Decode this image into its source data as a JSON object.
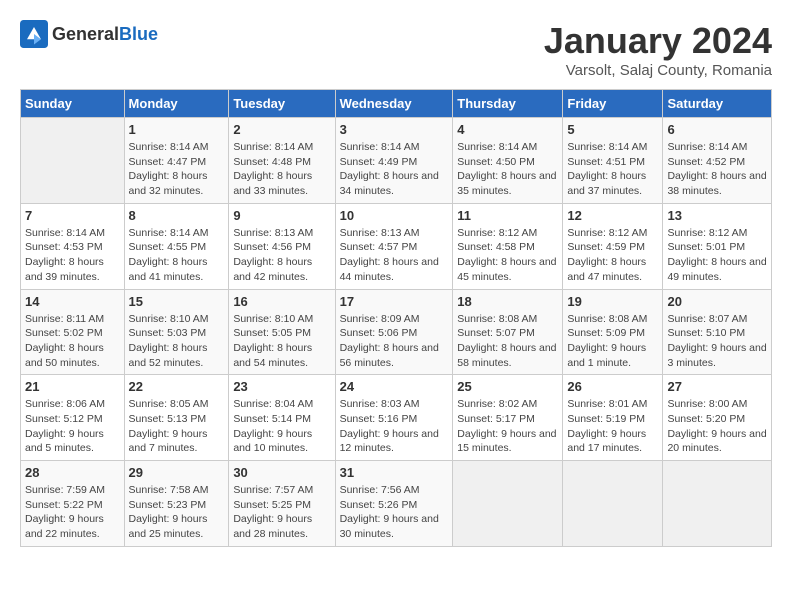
{
  "header": {
    "logo_general": "General",
    "logo_blue": "Blue",
    "month_title": "January 2024",
    "subtitle": "Varsolt, Salaj County, Romania"
  },
  "calendar": {
    "days_of_week": [
      "Sunday",
      "Monday",
      "Tuesday",
      "Wednesday",
      "Thursday",
      "Friday",
      "Saturday"
    ],
    "weeks": [
      [
        {
          "day": "",
          "sunrise": "",
          "sunset": "",
          "daylight": ""
        },
        {
          "day": "1",
          "sunrise": "Sunrise: 8:14 AM",
          "sunset": "Sunset: 4:47 PM",
          "daylight": "Daylight: 8 hours and 32 minutes."
        },
        {
          "day": "2",
          "sunrise": "Sunrise: 8:14 AM",
          "sunset": "Sunset: 4:48 PM",
          "daylight": "Daylight: 8 hours and 33 minutes."
        },
        {
          "day": "3",
          "sunrise": "Sunrise: 8:14 AM",
          "sunset": "Sunset: 4:49 PM",
          "daylight": "Daylight: 8 hours and 34 minutes."
        },
        {
          "day": "4",
          "sunrise": "Sunrise: 8:14 AM",
          "sunset": "Sunset: 4:50 PM",
          "daylight": "Daylight: 8 hours and 35 minutes."
        },
        {
          "day": "5",
          "sunrise": "Sunrise: 8:14 AM",
          "sunset": "Sunset: 4:51 PM",
          "daylight": "Daylight: 8 hours and 37 minutes."
        },
        {
          "day": "6",
          "sunrise": "Sunrise: 8:14 AM",
          "sunset": "Sunset: 4:52 PM",
          "daylight": "Daylight: 8 hours and 38 minutes."
        }
      ],
      [
        {
          "day": "7",
          "sunrise": "Sunrise: 8:14 AM",
          "sunset": "Sunset: 4:53 PM",
          "daylight": "Daylight: 8 hours and 39 minutes."
        },
        {
          "day": "8",
          "sunrise": "Sunrise: 8:14 AM",
          "sunset": "Sunset: 4:55 PM",
          "daylight": "Daylight: 8 hours and 41 minutes."
        },
        {
          "day": "9",
          "sunrise": "Sunrise: 8:13 AM",
          "sunset": "Sunset: 4:56 PM",
          "daylight": "Daylight: 8 hours and 42 minutes."
        },
        {
          "day": "10",
          "sunrise": "Sunrise: 8:13 AM",
          "sunset": "Sunset: 4:57 PM",
          "daylight": "Daylight: 8 hours and 44 minutes."
        },
        {
          "day": "11",
          "sunrise": "Sunrise: 8:12 AM",
          "sunset": "Sunset: 4:58 PM",
          "daylight": "Daylight: 8 hours and 45 minutes."
        },
        {
          "day": "12",
          "sunrise": "Sunrise: 8:12 AM",
          "sunset": "Sunset: 4:59 PM",
          "daylight": "Daylight: 8 hours and 47 minutes."
        },
        {
          "day": "13",
          "sunrise": "Sunrise: 8:12 AM",
          "sunset": "Sunset: 5:01 PM",
          "daylight": "Daylight: 8 hours and 49 minutes."
        }
      ],
      [
        {
          "day": "14",
          "sunrise": "Sunrise: 8:11 AM",
          "sunset": "Sunset: 5:02 PM",
          "daylight": "Daylight: 8 hours and 50 minutes."
        },
        {
          "day": "15",
          "sunrise": "Sunrise: 8:10 AM",
          "sunset": "Sunset: 5:03 PM",
          "daylight": "Daylight: 8 hours and 52 minutes."
        },
        {
          "day": "16",
          "sunrise": "Sunrise: 8:10 AM",
          "sunset": "Sunset: 5:05 PM",
          "daylight": "Daylight: 8 hours and 54 minutes."
        },
        {
          "day": "17",
          "sunrise": "Sunrise: 8:09 AM",
          "sunset": "Sunset: 5:06 PM",
          "daylight": "Daylight: 8 hours and 56 minutes."
        },
        {
          "day": "18",
          "sunrise": "Sunrise: 8:08 AM",
          "sunset": "Sunset: 5:07 PM",
          "daylight": "Daylight: 8 hours and 58 minutes."
        },
        {
          "day": "19",
          "sunrise": "Sunrise: 8:08 AM",
          "sunset": "Sunset: 5:09 PM",
          "daylight": "Daylight: 9 hours and 1 minute."
        },
        {
          "day": "20",
          "sunrise": "Sunrise: 8:07 AM",
          "sunset": "Sunset: 5:10 PM",
          "daylight": "Daylight: 9 hours and 3 minutes."
        }
      ],
      [
        {
          "day": "21",
          "sunrise": "Sunrise: 8:06 AM",
          "sunset": "Sunset: 5:12 PM",
          "daylight": "Daylight: 9 hours and 5 minutes."
        },
        {
          "day": "22",
          "sunrise": "Sunrise: 8:05 AM",
          "sunset": "Sunset: 5:13 PM",
          "daylight": "Daylight: 9 hours and 7 minutes."
        },
        {
          "day": "23",
          "sunrise": "Sunrise: 8:04 AM",
          "sunset": "Sunset: 5:14 PM",
          "daylight": "Daylight: 9 hours and 10 minutes."
        },
        {
          "day": "24",
          "sunrise": "Sunrise: 8:03 AM",
          "sunset": "Sunset: 5:16 PM",
          "daylight": "Daylight: 9 hours and 12 minutes."
        },
        {
          "day": "25",
          "sunrise": "Sunrise: 8:02 AM",
          "sunset": "Sunset: 5:17 PM",
          "daylight": "Daylight: 9 hours and 15 minutes."
        },
        {
          "day": "26",
          "sunrise": "Sunrise: 8:01 AM",
          "sunset": "Sunset: 5:19 PM",
          "daylight": "Daylight: 9 hours and 17 minutes."
        },
        {
          "day": "27",
          "sunrise": "Sunrise: 8:00 AM",
          "sunset": "Sunset: 5:20 PM",
          "daylight": "Daylight: 9 hours and 20 minutes."
        }
      ],
      [
        {
          "day": "28",
          "sunrise": "Sunrise: 7:59 AM",
          "sunset": "Sunset: 5:22 PM",
          "daylight": "Daylight: 9 hours and 22 minutes."
        },
        {
          "day": "29",
          "sunrise": "Sunrise: 7:58 AM",
          "sunset": "Sunset: 5:23 PM",
          "daylight": "Daylight: 9 hours and 25 minutes."
        },
        {
          "day": "30",
          "sunrise": "Sunrise: 7:57 AM",
          "sunset": "Sunset: 5:25 PM",
          "daylight": "Daylight: 9 hours and 28 minutes."
        },
        {
          "day": "31",
          "sunrise": "Sunrise: 7:56 AM",
          "sunset": "Sunset: 5:26 PM",
          "daylight": "Daylight: 9 hours and 30 minutes."
        },
        {
          "day": "",
          "sunrise": "",
          "sunset": "",
          "daylight": ""
        },
        {
          "day": "",
          "sunrise": "",
          "sunset": "",
          "daylight": ""
        },
        {
          "day": "",
          "sunrise": "",
          "sunset": "",
          "daylight": ""
        }
      ]
    ]
  }
}
